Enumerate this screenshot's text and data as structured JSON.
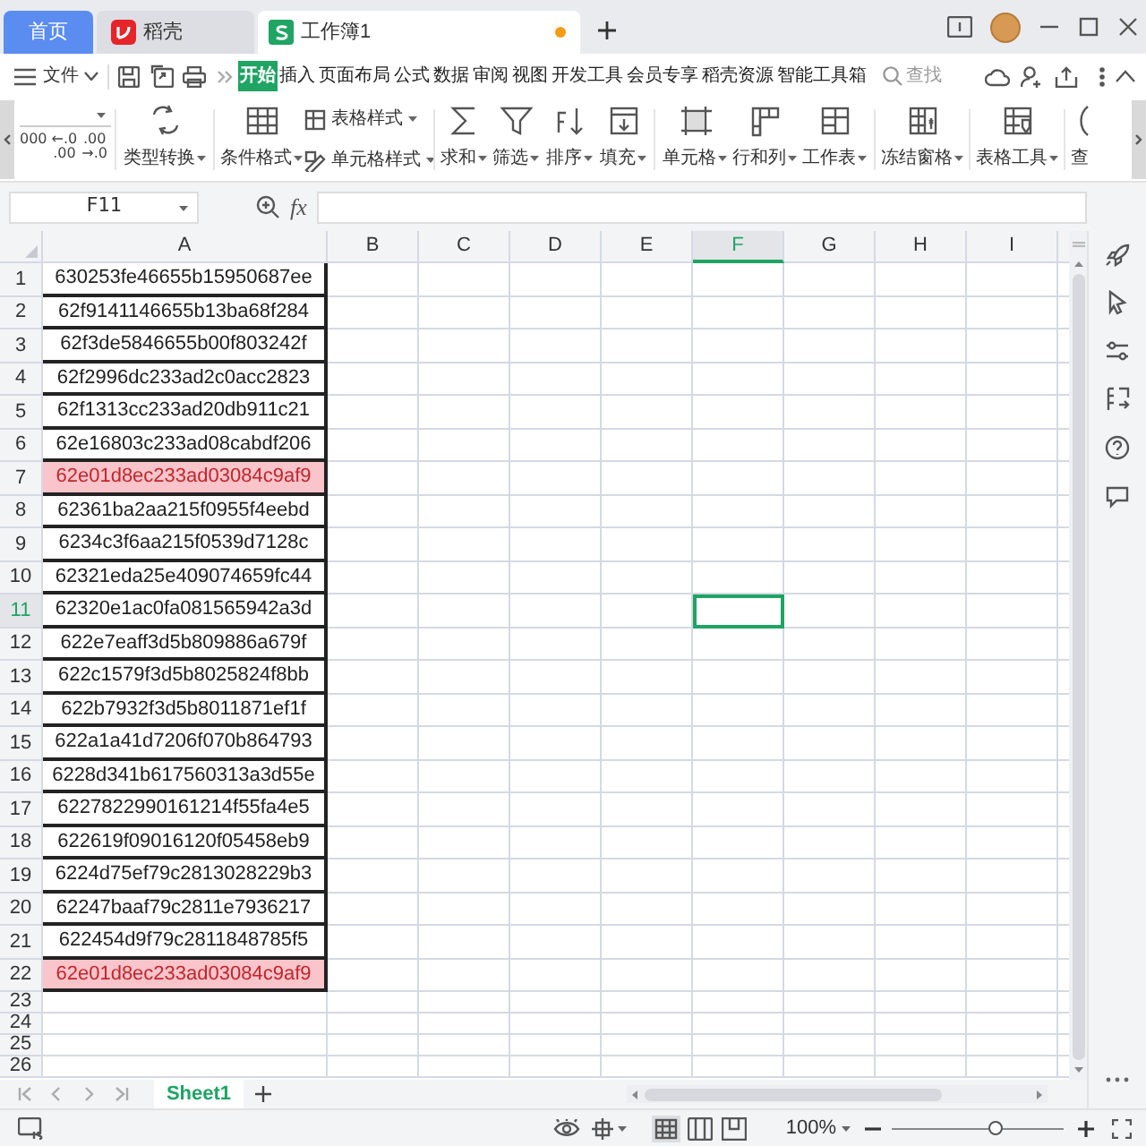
{
  "tabs": [
    {
      "label": "首页",
      "selected": false,
      "kind": "home"
    },
    {
      "label": "稻壳",
      "selected": false,
      "kind": "docer"
    },
    {
      "label": "工作簿1",
      "selected": true,
      "kind": "sheet"
    }
  ],
  "menu": {
    "file": "文件",
    "ribbon_tabs": [
      {
        "label": "开始",
        "selected": true
      },
      {
        "label": "插入",
        "selected": false
      },
      {
        "label": "页面布局",
        "selected": false
      },
      {
        "label": "公式",
        "selected": false
      },
      {
        "label": "数据",
        "selected": false
      },
      {
        "label": "审阅",
        "selected": false
      },
      {
        "label": "视图",
        "selected": false
      },
      {
        "label": "开发工具",
        "selected": false
      },
      {
        "label": "会员专享",
        "selected": false
      },
      {
        "label": "稻壳资源",
        "selected": false
      },
      {
        "label": "智能工具箱",
        "selected": false
      }
    ],
    "search": {
      "placeholder": "查找"
    }
  },
  "ribbon": {
    "number_formats": [
      [
        "000"
      ],
      [
        "←.0",
        ".00"
      ],
      [
        ".00",
        "→.0"
      ]
    ],
    "groups": [
      [
        {
          "kind": "large",
          "label": "类型转换"
        }
      ],
      [
        {
          "kind": "large",
          "label": "条件格式"
        },
        {
          "kind": "small",
          "label": "表格样式"
        },
        {
          "kind": "small",
          "label": "单元格样式"
        }
      ],
      [
        {
          "kind": "large",
          "label": "求和"
        },
        {
          "kind": "large",
          "label": "筛选"
        },
        {
          "kind": "large",
          "label": "排序"
        },
        {
          "kind": "large",
          "label": "填充"
        }
      ],
      [
        {
          "kind": "large",
          "label": "单元格"
        },
        {
          "kind": "large",
          "label": "行和列"
        },
        {
          "kind": "large",
          "label": "工作表"
        }
      ],
      [
        {
          "kind": "large",
          "label": "冻结窗格"
        }
      ],
      [
        {
          "kind": "large",
          "label": "表格工具"
        }
      ],
      [
        {
          "kind": "large",
          "label": "查"
        }
      ]
    ]
  },
  "formula_bar": {
    "name_box": "F11",
    "fx_label": "fx"
  },
  "grid": {
    "columns": [
      {
        "label": "A",
        "selected": false
      },
      {
        "label": "B",
        "selected": false
      },
      {
        "label": "C",
        "selected": false
      },
      {
        "label": "D",
        "selected": false
      },
      {
        "label": "E",
        "selected": false
      },
      {
        "label": "F",
        "selected": true
      },
      {
        "label": "G",
        "selected": false
      },
      {
        "label": "H",
        "selected": false
      },
      {
        "label": "I",
        "selected": false
      }
    ],
    "rows": [
      {
        "number": "1",
        "value": "630253fe46655b15950687ee",
        "highlighted": false,
        "selected": false
      },
      {
        "number": "2",
        "value": "62f9141146655b13ba68f284",
        "highlighted": false,
        "selected": false
      },
      {
        "number": "3",
        "value": "62f3de5846655b00f803242f",
        "highlighted": false,
        "selected": false
      },
      {
        "number": "4",
        "value": "62f2996dc233ad2c0acc2823",
        "highlighted": false,
        "selected": false
      },
      {
        "number": "5",
        "value": "62f1313cc233ad20db911c21",
        "highlighted": false,
        "selected": false
      },
      {
        "number": "6",
        "value": "62e16803c233ad08cabdf206",
        "highlighted": false,
        "selected": false
      },
      {
        "number": "7",
        "value": "62e01d8ec233ad03084c9af9",
        "highlighted": true,
        "selected": false
      },
      {
        "number": "8",
        "value": "62361ba2aa215f0955f4eebd",
        "highlighted": false,
        "selected": false
      },
      {
        "number": "9",
        "value": "6234c3f6aa215f0539d7128c",
        "highlighted": false,
        "selected": false
      },
      {
        "number": "10",
        "value": "62321eda25e409074659fc44",
        "highlighted": false,
        "selected": false
      },
      {
        "number": "11",
        "value": "62320e1ac0fa081565942a3d",
        "highlighted": false,
        "selected": true
      },
      {
        "number": "12",
        "value": "622e7eaff3d5b809886a679f",
        "highlighted": false,
        "selected": false
      },
      {
        "number": "13",
        "value": "622c1579f3d5b8025824f8bb",
        "highlighted": false,
        "selected": false
      },
      {
        "number": "14",
        "value": "622b7932f3d5b8011871ef1f",
        "highlighted": false,
        "selected": false
      },
      {
        "number": "15",
        "value": "622a1a41d7206f070b864793",
        "highlighted": false,
        "selected": false
      },
      {
        "number": "16",
        "value": "6228d341b617560313a3d55e",
        "highlighted": false,
        "selected": false
      },
      {
        "number": "17",
        "value": "6227822990161214f55fa4e5",
        "highlighted": false,
        "selected": false
      },
      {
        "number": "18",
        "value": "622619f09016120f05458eb9",
        "highlighted": false,
        "selected": false
      },
      {
        "number": "19",
        "value": "6224d75ef79c2813028229b3",
        "highlighted": false,
        "selected": false
      },
      {
        "number": "20",
        "value": "62247baaf79c2811e7936217",
        "highlighted": false,
        "selected": false
      },
      {
        "number": "21",
        "value": "622454d9f79c2811848785f5",
        "highlighted": false,
        "selected": false
      },
      {
        "number": "22",
        "value": "62e01d8ec233ad03084c9af9",
        "highlighted": true,
        "selected": false
      },
      {
        "number": "23",
        "selected": false
      },
      {
        "number": "24",
        "selected": false
      },
      {
        "number": "25",
        "selected": false
      },
      {
        "number": "26",
        "selected": false
      }
    ]
  },
  "sheets": [
    {
      "label": "Sheet1",
      "selected": true
    }
  ],
  "status_bar": {
    "zoom": "100%",
    "zoom_slider": {
      "level": 0.6
    }
  }
}
